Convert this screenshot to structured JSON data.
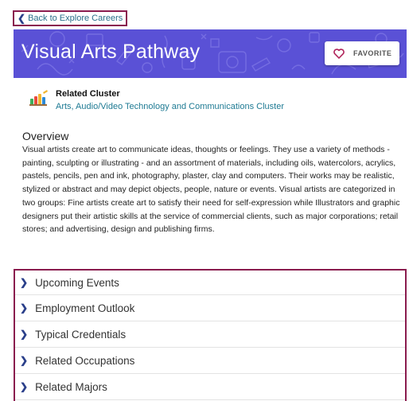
{
  "back_link": {
    "label": "Back to Explore Careers"
  },
  "banner": {
    "title": "Visual Arts Pathway",
    "favorite_label": "FAVORITE",
    "background_color": "#5a51d6"
  },
  "cluster": {
    "heading": "Related Cluster",
    "link": "Arts, Audio/Video Technology and Communications Cluster"
  },
  "overview": {
    "title": "Overview",
    "body": "Visual artists create art to communicate ideas, thoughts or feelings. They use a variety of methods - painting, sculpting or illustrating - and an assortment of materials, including oils, watercolors, acrylics, pastels, pencils, pen and ink, photography, plaster, clay and computers. Their works may be realistic, stylized or abstract and may depict objects, people, nature or events. Visual artists are categorized in two groups: Fine artists create art to satisfy their need for self-expression while Illustrators and graphic designers put their artistic skills at the service of commercial clients, such as major corporations; retail stores; and advertising, design and publishing firms."
  },
  "accordion": {
    "items": [
      {
        "label": "Upcoming Events"
      },
      {
        "label": "Employment Outlook"
      },
      {
        "label": "Typical Credentials"
      },
      {
        "label": "Related Occupations"
      },
      {
        "label": "Related Majors"
      }
    ]
  },
  "colors": {
    "highlight_border": "#8a1c4e",
    "link": "#1e7a93",
    "chevron": "#2a3f8a"
  }
}
